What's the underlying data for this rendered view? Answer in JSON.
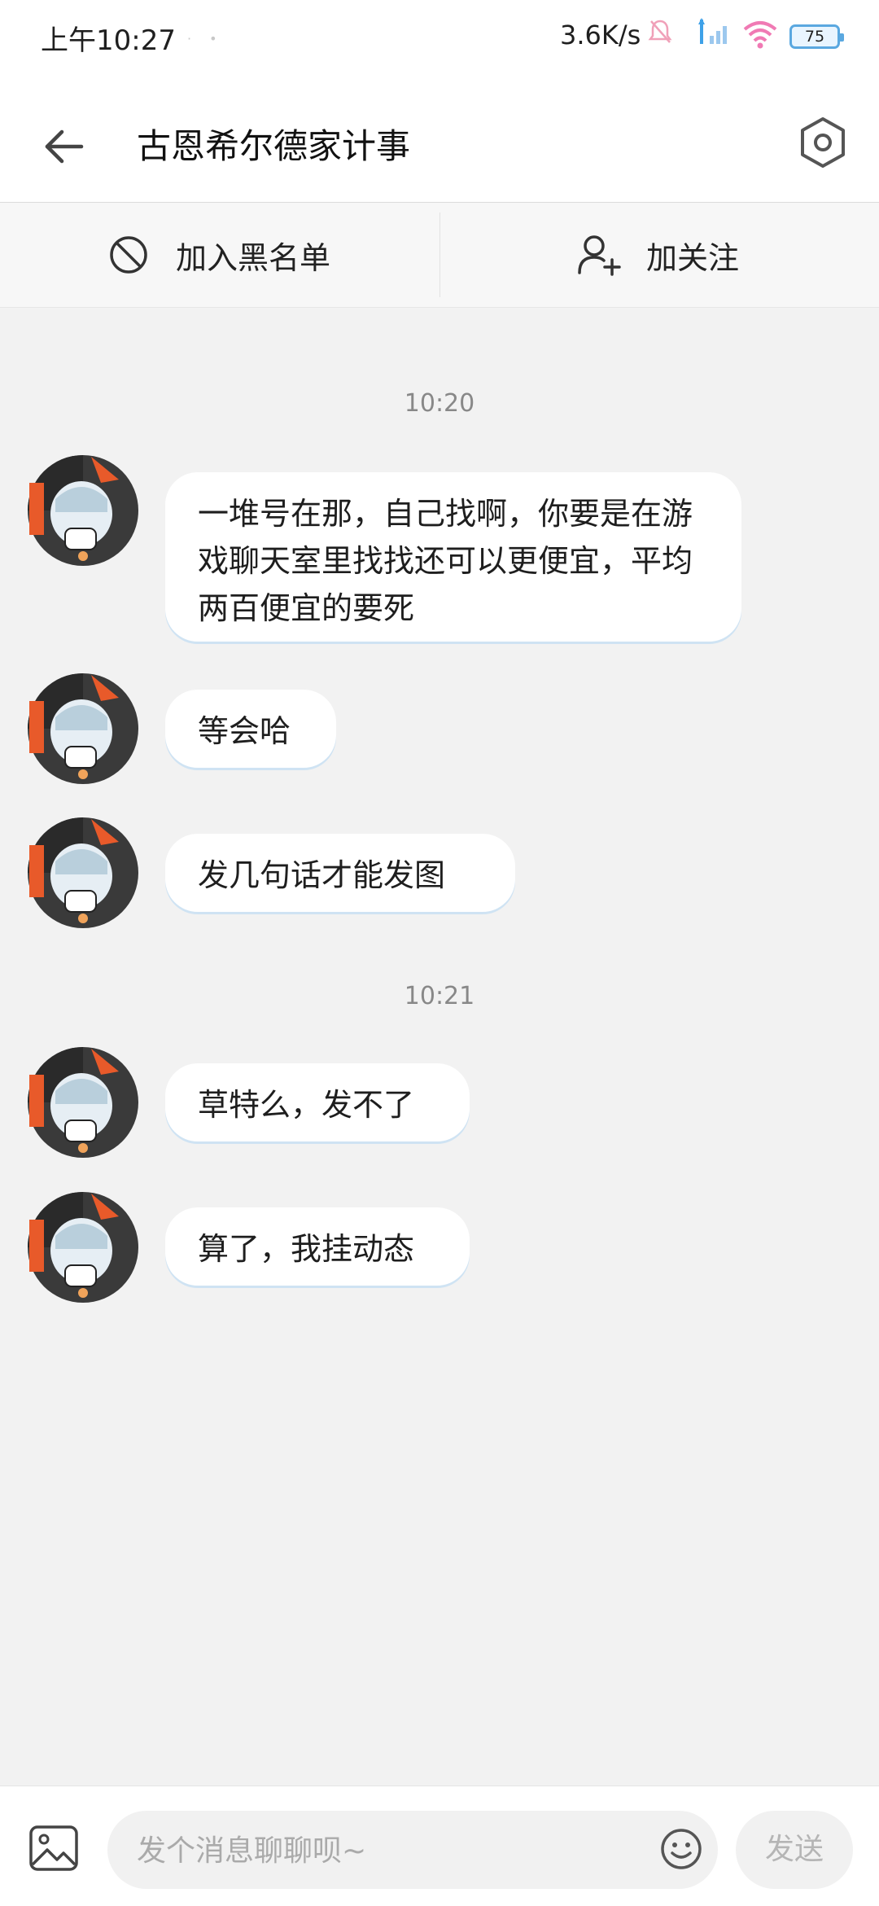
{
  "status_bar": {
    "time": "上午10:27",
    "net_speed": "3.6K/s",
    "battery": "75"
  },
  "header": {
    "title": "古恩希尔德家计事"
  },
  "actions": {
    "block_label": "加入黑名单",
    "follow_label": "加关注"
  },
  "chat": {
    "groups": [
      {
        "timestamp": "10:20",
        "messages": [
          {
            "text": "一堆号在那，自己找啊，你要是在游戏聊天室里找找还可以更便宜，平均两百便宜的要死"
          },
          {
            "text": "等会哈"
          },
          {
            "text": "发几句话才能发图"
          }
        ]
      },
      {
        "timestamp": "10:21",
        "messages": [
          {
            "text": "草特么，发不了"
          },
          {
            "text": "算了，我挂动态"
          }
        ]
      }
    ]
  },
  "input": {
    "placeholder": "发个消息聊聊呗~",
    "send_label": "发送"
  },
  "colors": {
    "bubble_shadow": "#cfe3f3",
    "background": "#f2f2f2"
  }
}
